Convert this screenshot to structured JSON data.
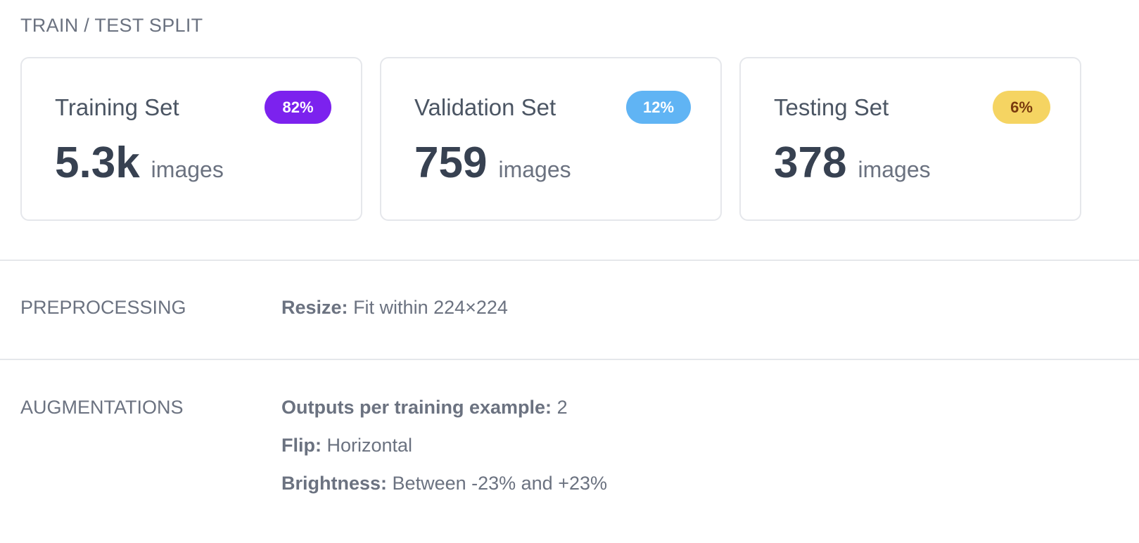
{
  "split": {
    "title": "TRAIN / TEST SPLIT",
    "cards": [
      {
        "title": "Training Set",
        "badge": "82%",
        "value": "5.3k",
        "unit": "images",
        "badge_color": "#7c22ee"
      },
      {
        "title": "Validation Set",
        "badge": "12%",
        "value": "759",
        "unit": "images",
        "badge_color": "#60b4f4"
      },
      {
        "title": "Testing Set",
        "badge": "6%",
        "value": "378",
        "unit": "images",
        "badge_color": "#f5d462"
      }
    ]
  },
  "preprocessing": {
    "label": "PREPROCESSING",
    "items": [
      {
        "key": "Resize:",
        "value": "Fit within 224×224"
      }
    ]
  },
  "augmentations": {
    "label": "AUGMENTATIONS",
    "items": [
      {
        "key": "Outputs per training example:",
        "value": "2"
      },
      {
        "key": "Flip:",
        "value": "Horizontal"
      },
      {
        "key": "Brightness:",
        "value": "Between -23% and +23%"
      }
    ]
  }
}
